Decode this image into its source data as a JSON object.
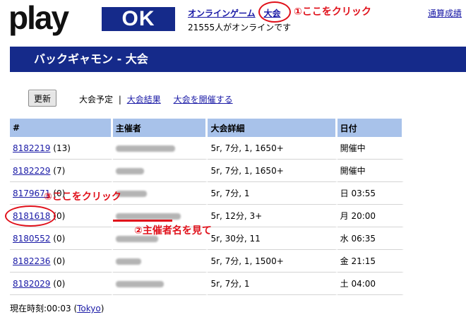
{
  "brand": {
    "logo_left": "play",
    "logo_right": "OK"
  },
  "topnav": {
    "online_games": "オンラインゲーム",
    "tournaments": "大会",
    "rating": "通算成績"
  },
  "online_count": "21555人がオンラインです",
  "header": {
    "title": "バックギャモン - 大会"
  },
  "toolbar": {
    "refresh": "更新",
    "scheduled": "大会予定",
    "separator": "|",
    "results": "大会結果",
    "host": "大会を開催する"
  },
  "table": {
    "columns": [
      "#",
      "主催者",
      "大会詳細",
      "日付"
    ],
    "rows": [
      {
        "id": "8182219",
        "count": "(13)",
        "details": "5r, 7分, 1, 1650+",
        "date": "開催中"
      },
      {
        "id": "8182229",
        "count": "(7)",
        "details": "5r, 7分, 1, 1650+",
        "date": "開催中"
      },
      {
        "id": "8179671",
        "count": "(0)",
        "details": "5r, 7分, 1",
        "date": "日 03:55"
      },
      {
        "id": "8181618",
        "count": "(0)",
        "details": "5r, 12分, 3+",
        "date": "月 20:00"
      },
      {
        "id": "8180552",
        "count": "(0)",
        "details": "5r, 30分, 11",
        "date": "水 06:35"
      },
      {
        "id": "8182236",
        "count": "(0)",
        "details": "5r, 7分, 1, 1500+",
        "date": "金 21:15"
      },
      {
        "id": "8182029",
        "count": "(0)",
        "details": "5r, 7分, 1",
        "date": "土 04:00"
      }
    ]
  },
  "current_time": {
    "label": "現在時刻:00:03 (",
    "zone": "Tokyo",
    "suffix": ")"
  },
  "annotations": {
    "step1": "①ここをクリック",
    "step2": "②主催者名を見て",
    "step3": "③ここをクリック"
  },
  "colors": {
    "brand_blue": "#152a8a",
    "table_header": "#a8c2ea",
    "link": "#1a1aa6",
    "annotation_red": "#e0101a"
  }
}
